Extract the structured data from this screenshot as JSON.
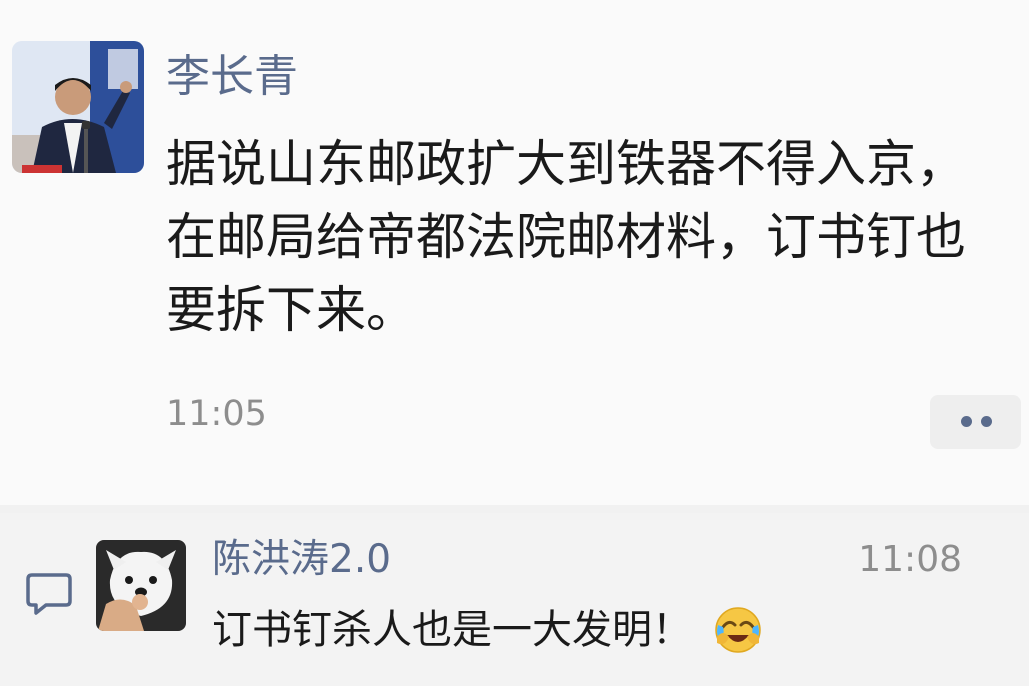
{
  "post": {
    "author": "李长青",
    "text": "据说山东邮政扩大到铁器不得入京，在邮局给帝都法院邮材料，订书钉也要拆下来。",
    "time": "11:05",
    "avatar_icon": "person-photo-avatar",
    "more_icon": "two-dots-icon"
  },
  "comments": [
    {
      "author": "陈洪涛2.0",
      "time": "11:08",
      "text": "订书钉杀人也是一大发明！",
      "emoji": "crying-laughing-emoji",
      "avatar_icon": "dog-photo-avatar"
    }
  ],
  "colors": {
    "name_link": "#5a6b8c",
    "timestamp": "#8d8d8d",
    "body_text": "#1a1a1a"
  }
}
